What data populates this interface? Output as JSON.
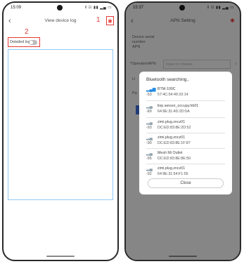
{
  "left_phone": {
    "status": {
      "time": "15:09",
      "icons": " ‖ ☷ ▮▮ ▂▄ ▭"
    },
    "nav": {
      "back": "‹",
      "title": "View device log"
    },
    "annotations": {
      "one": "1",
      "two": "2"
    },
    "detailed_log": {
      "label": "Detailed log",
      "enabled": false
    },
    "bluetooth_icon": "✱"
  },
  "right_phone": {
    "status": {
      "time": "15:37",
      "icons": "‖ ☷ ▮▮ ▂▄ ▭"
    },
    "nav": {
      "back": "‹",
      "title": "APN Setting"
    },
    "bluetooth_icon": "✱",
    "fields": {
      "serial_line1": "Device serial",
      "serial_line2": "number",
      "apn": "APN",
      "operator_label": "*Operator\\APN",
      "operator_placeholder": "Input or choose",
      "user_partial": "U",
      "password_partial": "Pa"
    },
    "modal": {
      "title": "Bluetooth searching..",
      "devices": [
        {
          "name": "BTM-100C",
          "rssi": "-53",
          "mac": "57:4C:54:49:10:14",
          "signal": "▂▄▆"
        },
        {
          "name": "linp.sensor_occupy.hb01",
          "rssi": "-89",
          "mac": "64:9E:31:4D:2D:5A",
          "signal": "▂▄"
        },
        {
          "name": "zimi.plug.zncz01",
          "rssi": "-93",
          "mac": "DC:ED:83:8E:2D:52",
          "signal": "▂▄"
        },
        {
          "name": "zimi.plug.zncz01",
          "rssi": "-90",
          "mac": "DC:ED:83:8E:1F:87",
          "signal": "▂▄"
        },
        {
          "name": "Mesh Mi Outlet",
          "rssi": "-95",
          "mac": "DC:ED:83:8E:8E:50",
          "signal": "▂▄"
        },
        {
          "name": "zimi.plug.zncz01",
          "rssi": "-92",
          "mac": "64:9E:31:54:F1:55",
          "signal": "▂▄"
        }
      ],
      "close_label": "Close"
    }
  },
  "colors": {
    "highlight": "#e53935",
    "accent": "#1e88e5"
  }
}
